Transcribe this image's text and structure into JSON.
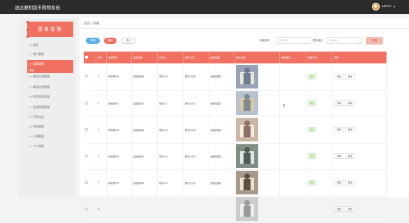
{
  "app": {
    "title": "送达便利超市购物系统",
    "username": "admin"
  },
  "sidebar": {
    "banner": "菜单管理",
    "items": [
      {
        "icon": "◎",
        "label": "首页",
        "chevron": false
      },
      {
        "icon": "≡",
        "label": "用户管理",
        "chevron": true
      },
      {
        "icon": "≡",
        "label": "商家管理",
        "chevron": true,
        "active": true
      },
      {
        "icon": "≡",
        "label": "商品分类管理",
        "chevron": true
      },
      {
        "icon": "≡",
        "label": "商品信息管理",
        "chevron": true
      },
      {
        "icon": "≡",
        "label": "供货商品管理",
        "chevron": true
      },
      {
        "icon": "≡",
        "label": "在线促销管理",
        "chevron": true
      },
      {
        "icon": "≡",
        "label": "供货出品",
        "chevron": true
      },
      {
        "icon": "≡",
        "label": "系统管理",
        "chevron": true
      },
      {
        "icon": "≡",
        "label": "订单管理",
        "chevron": true
      },
      {
        "icon": "≡",
        "label": "个人资料",
        "chevron": true
      }
    ],
    "active_sub": "商家"
  },
  "breadcrumb": "首页 / 商家",
  "toolbar": {
    "add": "新增",
    "delete": "删除",
    "stats": "统计"
  },
  "filters": {
    "name_label": "店铺名称",
    "name_placeholder": "店铺名称",
    "status_label": "是否通过",
    "status_placeholder": "是否通过",
    "search": "查询"
  },
  "table": {
    "headers": [
      "",
      "索引",
      "商家账号",
      "店铺名称",
      "联系人",
      "联系方式",
      "经营范围",
      "营业执照",
      "审核回复",
      "审核状态",
      "操作"
    ],
    "rows": [
      {
        "index": "1",
        "account": "商家账号8",
        "shop": "店铺名称8",
        "contact": "联系人8",
        "phone": "联系方式8",
        "scope": "经营范围8",
        "reply": "",
        "status": "通过"
      },
      {
        "index": "2",
        "account": "商家账号7",
        "shop": "店铺名称7",
        "contact": "联系人7",
        "phone": "联系方式7",
        "scope": "经营范围7",
        "reply": "",
        "status": "通过"
      },
      {
        "index": "3",
        "account": "商家账号6",
        "shop": "店铺名称6",
        "contact": "联系人6",
        "phone": "联系方式6",
        "scope": "经营范围6",
        "reply": "",
        "status": "通过"
      },
      {
        "index": "4",
        "account": "商家账号5",
        "shop": "店铺名称5",
        "contact": "联系人5",
        "phone": "联系方式5",
        "scope": "经营范围5",
        "reply": "",
        "status": "通过"
      },
      {
        "index": "5",
        "account": "商家账号4",
        "shop": "店铺名称4",
        "contact": "联系人4",
        "phone": "联系方式4",
        "scope": "经营范围4",
        "reply": "",
        "status": "通过"
      },
      {
        "index": "6",
        "account": "",
        "shop": "",
        "contact": "",
        "phone": "",
        "scope": "",
        "reply": "",
        "status": ""
      }
    ],
    "actions": {
      "view": "查看",
      "delete": "删除"
    }
  },
  "colors": {
    "accent": "#f07161",
    "topbar": "#2b2b2b",
    "info": "#5bb0e8"
  }
}
